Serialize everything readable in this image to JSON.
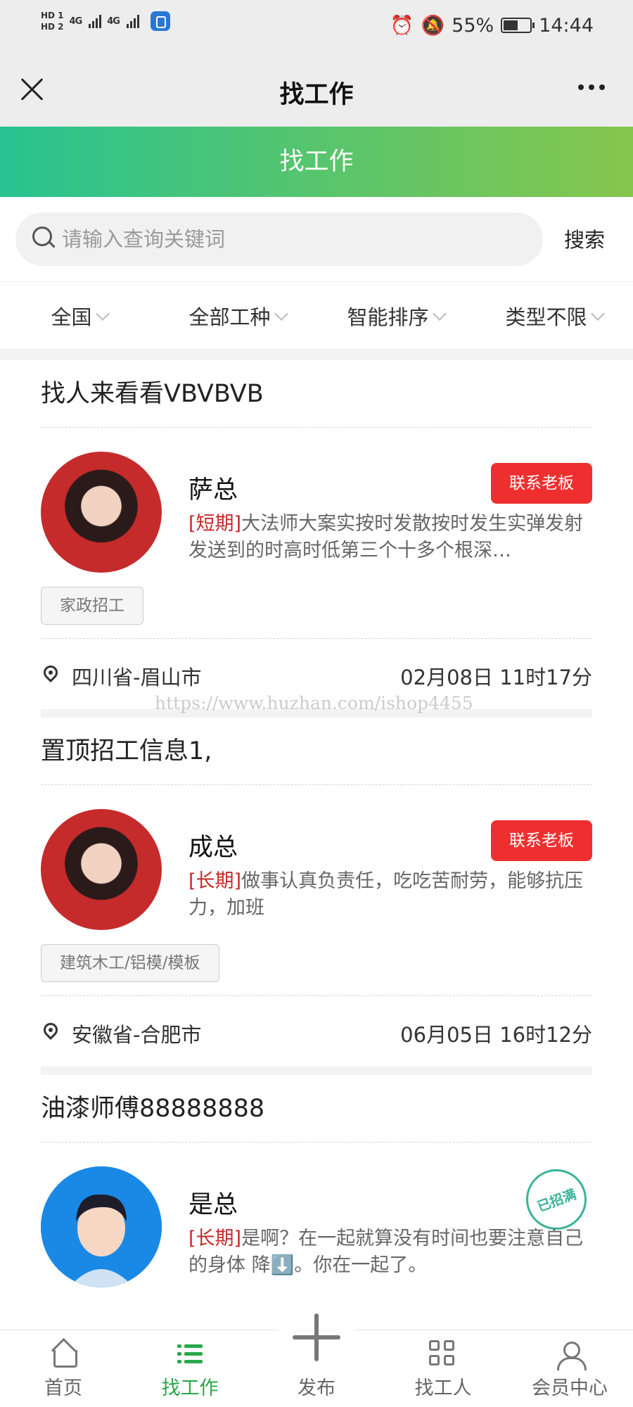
{
  "status_bar": {
    "hd1": "HD 1",
    "hd2": "HD 2",
    "net1": "4G",
    "net2": "4G",
    "battery": "55%",
    "time": "14:44"
  },
  "titlebar": {
    "title": "找工作"
  },
  "header": {
    "title": "找工作"
  },
  "search": {
    "placeholder": "请输入查询关键词",
    "button": "搜索"
  },
  "filters": [
    "全国",
    "全部工种",
    "智能排序",
    "类型不限"
  ],
  "watermark": "https://www.huzhan.com/ishop4455",
  "jobs": [
    {
      "title": "找人来看看VBVBVB",
      "boss": "萨总",
      "contact": "联系老板",
      "type": "[短期]",
      "desc": "大法师大案实按时发散按时发生实弹发射发送到的时高时低第三个十多个根深…",
      "tag": "家政招工",
      "location": "四川省-眉山市",
      "time": "02月08日 11时17分"
    },
    {
      "title": "置顶招工信息1,",
      "boss": "成总",
      "contact": "联系老板",
      "type": "[长期]",
      "desc": "做事认真负责任，吃吃苦耐劳，能够抗压力，加班",
      "tag": "建筑木工/铝模/模板",
      "location": "安徽省-合肥市",
      "time": "06月05日 16时12分"
    },
    {
      "title": "油漆师傅88888888",
      "boss": "是总",
      "stamp": "已招满",
      "type": "[长期]",
      "desc": "是啊？在一起就算没有时间也要注意自己的身体 降⬇️。你在一起了。"
    }
  ],
  "nav": {
    "home": "首页",
    "find_job": "找工作",
    "publish": "发布",
    "find_worker": "找工人",
    "member": "会员中心",
    "active": "find_job"
  },
  "colors": {
    "accent_green": "#2aa84a",
    "header_gradient_start": "#27c391",
    "header_gradient_end": "#86c64d",
    "contact_red": "#ef2f2f",
    "type_red": "#c62828"
  }
}
